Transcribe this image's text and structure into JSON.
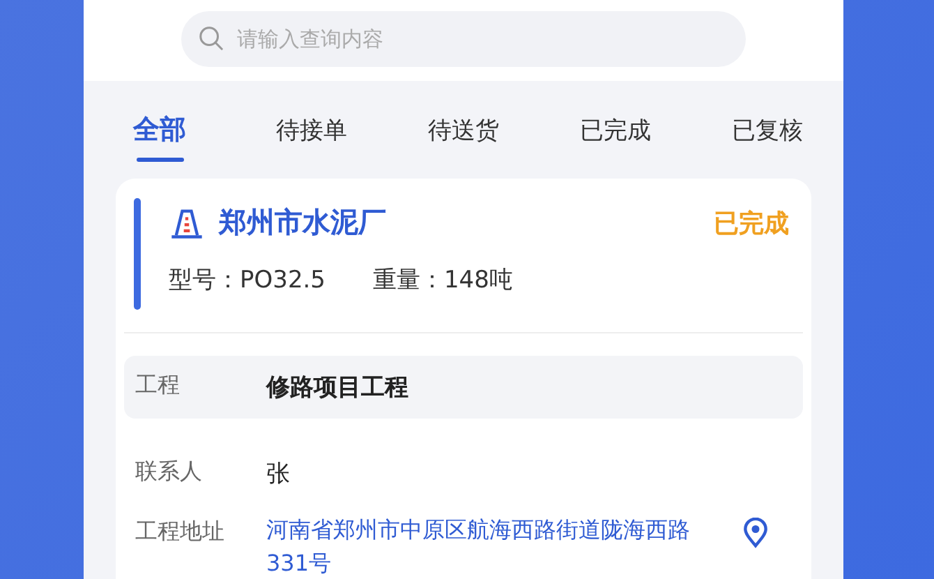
{
  "search": {
    "placeholder": "请输入查询内容"
  },
  "tabs": [
    {
      "label": "全部",
      "selected": true
    },
    {
      "label": "待接单",
      "selected": false
    },
    {
      "label": "待送货",
      "selected": false
    },
    {
      "label": "已完成",
      "selected": false
    },
    {
      "label": "已复核",
      "selected": false
    }
  ],
  "order": {
    "title": "郑州市水泥厂",
    "status": "已完成",
    "specs": [
      {
        "label": "型号：",
        "value": "PO32.5"
      },
      {
        "label": "重量：",
        "value": "148吨"
      }
    ],
    "details": [
      {
        "label": "工程",
        "value": "修路项目工程",
        "kind": "highlight"
      },
      {
        "label": "联系人",
        "value": "张",
        "kind": "plain"
      },
      {
        "label": "工程地址",
        "value": "河南省郑州市中原区航海西路街道陇海西路331号",
        "kind": "address"
      }
    ]
  }
}
